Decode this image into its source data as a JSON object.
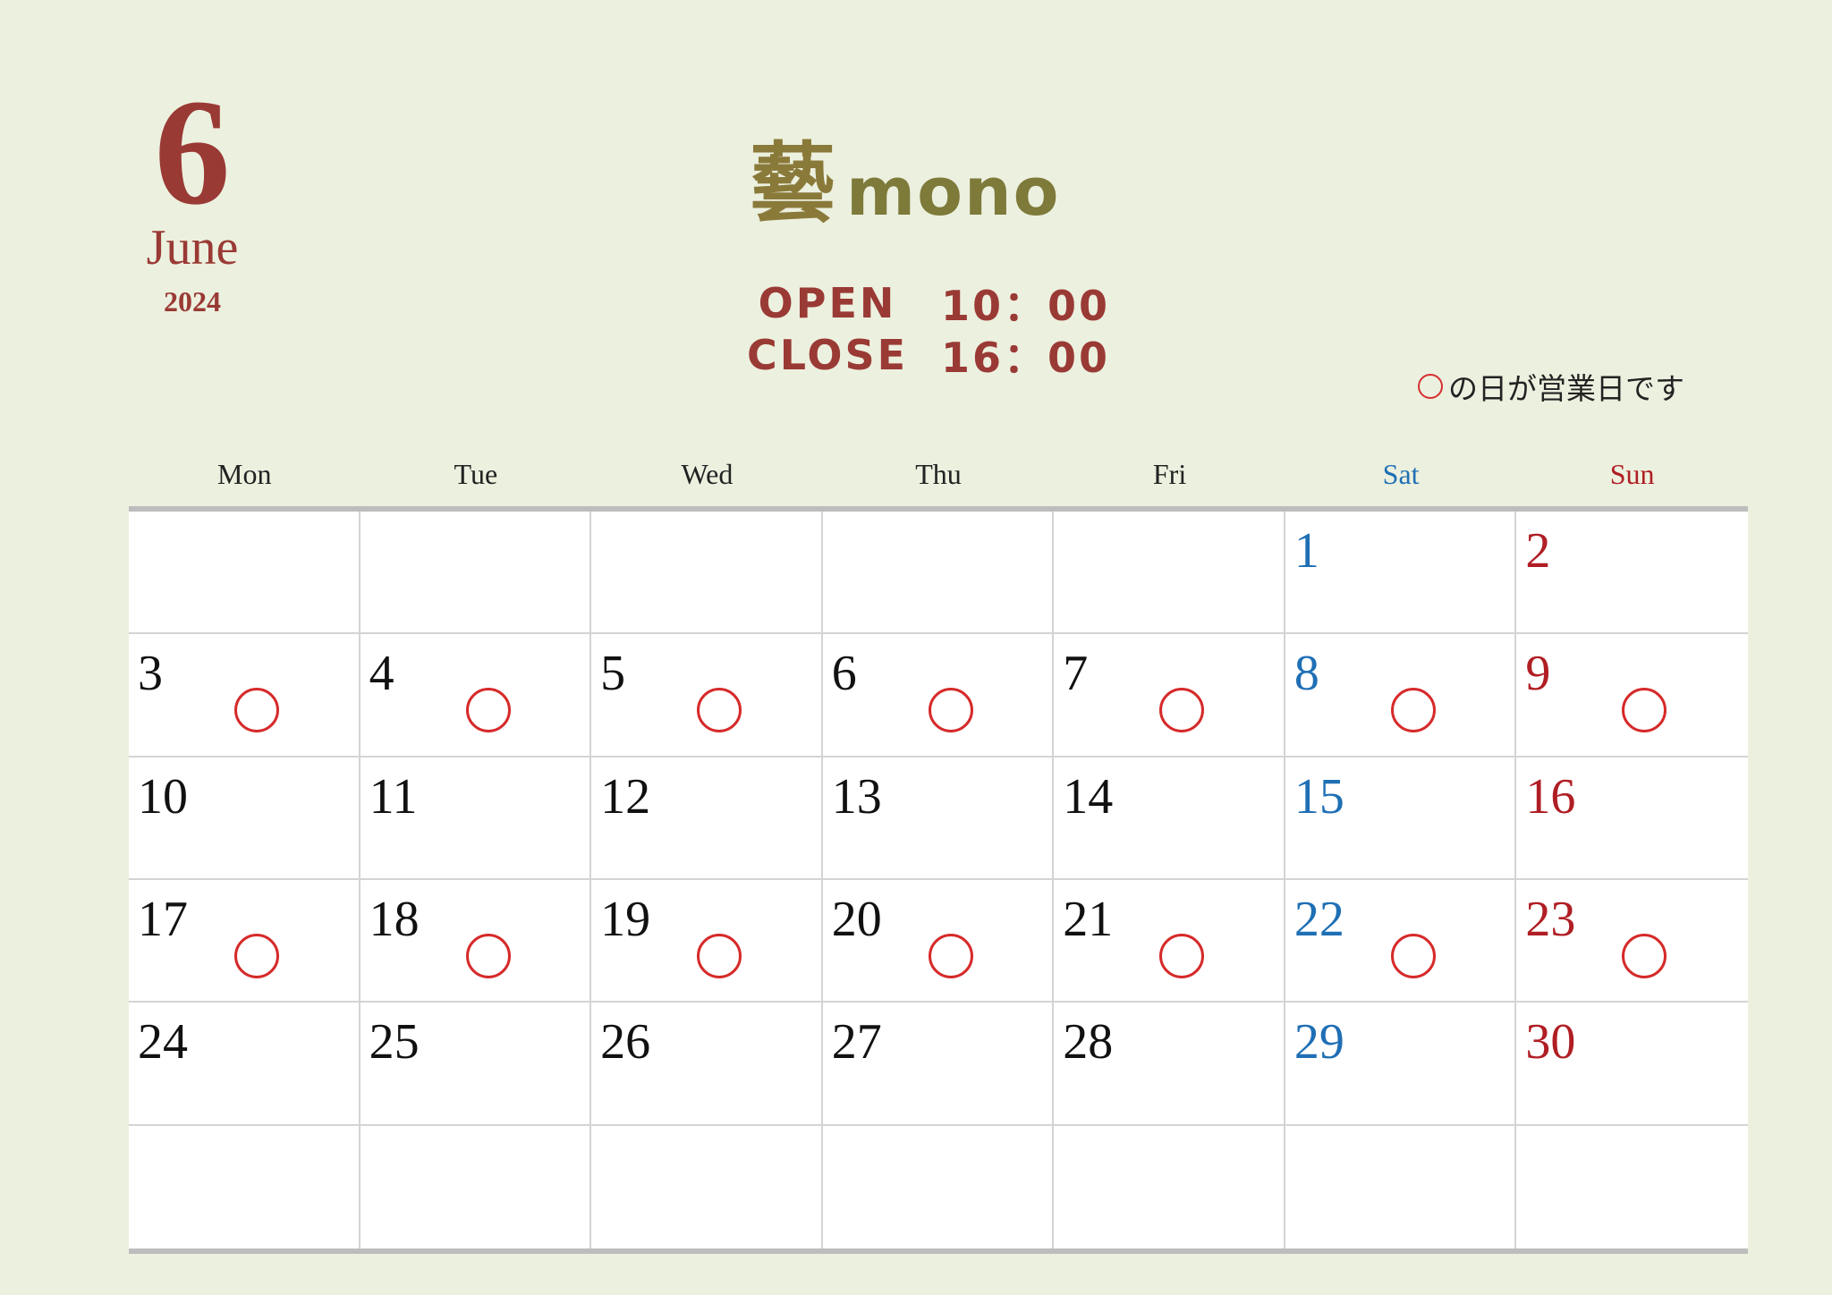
{
  "header": {
    "month_number": "6",
    "month_name": "June",
    "year": "2024",
    "logo_kanji": "藝",
    "logo_text": "mono",
    "open_label": "OPEN",
    "open_time": "10：00",
    "close_label": "CLOSE",
    "close_time": "16：00",
    "note_text": "の日が営業日です"
  },
  "colors": {
    "accent": "#9a3a35",
    "logo": "#7d7a3a",
    "saturday": "#1f6fb5",
    "sunday": "#b01e24",
    "open_circle": "#d62a2a",
    "background": "#ecf0df"
  },
  "weekdays": [
    "Mon",
    "Tue",
    "Wed",
    "Thu",
    "Fri",
    "Sat",
    "Sun"
  ],
  "weeks": [
    [
      {
        "day": ""
      },
      {
        "day": ""
      },
      {
        "day": ""
      },
      {
        "day": ""
      },
      {
        "day": ""
      },
      {
        "day": "1",
        "open": false
      },
      {
        "day": "2",
        "open": false
      }
    ],
    [
      {
        "day": "3",
        "open": true
      },
      {
        "day": "4",
        "open": true
      },
      {
        "day": "5",
        "open": true
      },
      {
        "day": "6",
        "open": true
      },
      {
        "day": "7",
        "open": true
      },
      {
        "day": "8",
        "open": true
      },
      {
        "day": "9",
        "open": true
      }
    ],
    [
      {
        "day": "10",
        "open": false
      },
      {
        "day": "11",
        "open": false
      },
      {
        "day": "12",
        "open": false
      },
      {
        "day": "13",
        "open": false
      },
      {
        "day": "14",
        "open": false
      },
      {
        "day": "15",
        "open": false
      },
      {
        "day": "16",
        "open": false
      }
    ],
    [
      {
        "day": "17",
        "open": true
      },
      {
        "day": "18",
        "open": true
      },
      {
        "day": "19",
        "open": true
      },
      {
        "day": "20",
        "open": true
      },
      {
        "day": "21",
        "open": true
      },
      {
        "day": "22",
        "open": true
      },
      {
        "day": "23",
        "open": true
      }
    ],
    [
      {
        "day": "24",
        "open": false
      },
      {
        "day": "25",
        "open": false
      },
      {
        "day": "26",
        "open": false
      },
      {
        "day": "27",
        "open": false
      },
      {
        "day": "28",
        "open": false
      },
      {
        "day": "29",
        "open": false
      },
      {
        "day": "30",
        "open": false
      }
    ],
    [
      {
        "day": ""
      },
      {
        "day": ""
      },
      {
        "day": ""
      },
      {
        "day": ""
      },
      {
        "day": ""
      },
      {
        "day": ""
      },
      {
        "day": ""
      }
    ]
  ]
}
